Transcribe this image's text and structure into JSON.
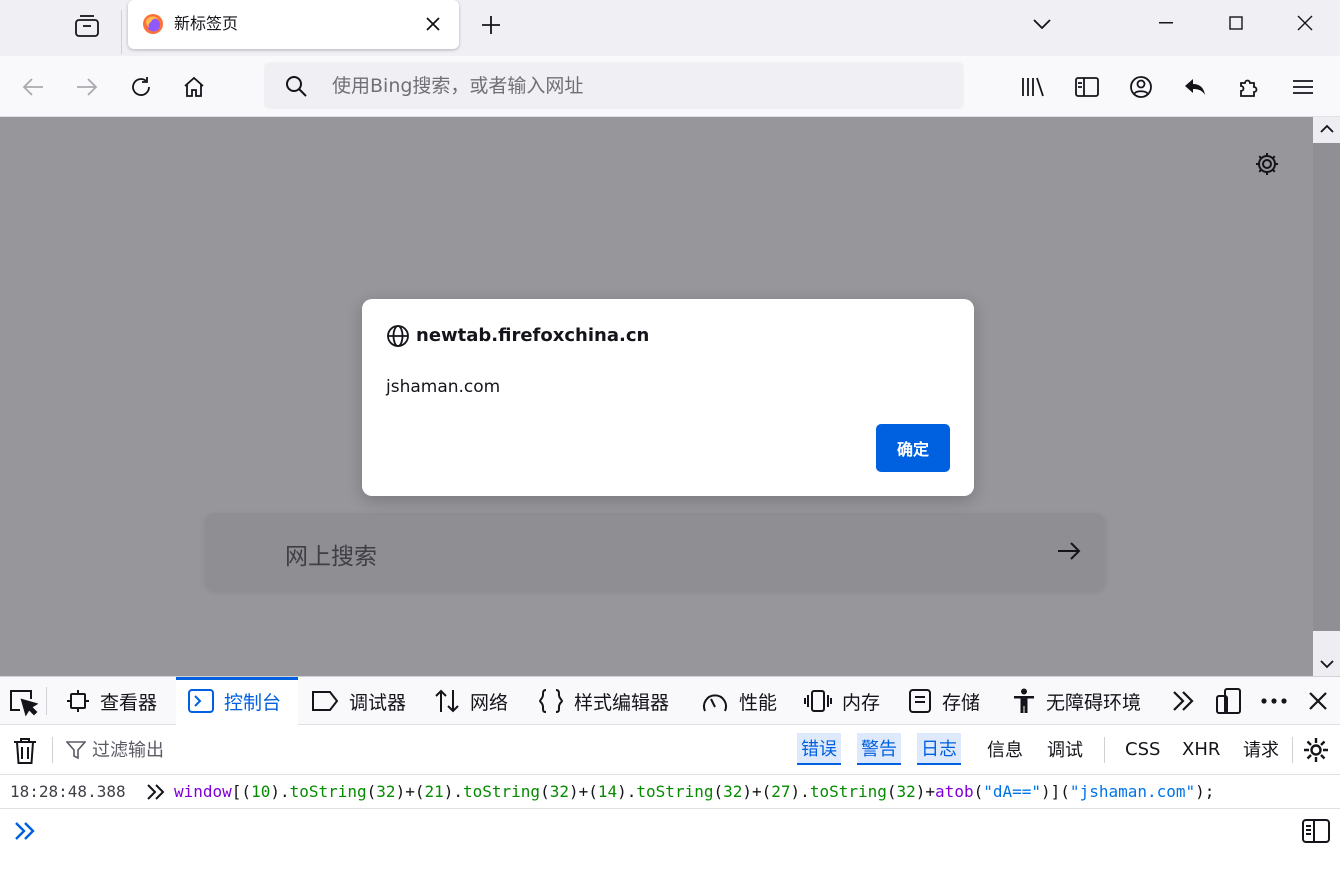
{
  "browser": {
    "tab": {
      "title": "新标签页"
    },
    "urlbar": {
      "placeholder": "使用Bing搜索，或者输入网址"
    }
  },
  "content": {
    "search_text": "网上搜索"
  },
  "dialog": {
    "origin": "newtab.firefoxchina.cn",
    "message": "jshaman.com",
    "ok_label": "确定"
  },
  "devtools": {
    "tabs": [
      {
        "label": "查看器",
        "icon": "inspector-icon"
      },
      {
        "label": "控制台",
        "icon": "console-icon",
        "active": true
      },
      {
        "label": "调试器",
        "icon": "debugger-icon"
      },
      {
        "label": "网络",
        "icon": "network-icon"
      },
      {
        "label": "样式编辑器",
        "icon": "style-editor-icon"
      },
      {
        "label": "性能",
        "icon": "performance-icon"
      },
      {
        "label": "内存",
        "icon": "memory-icon"
      },
      {
        "label": "存储",
        "icon": "storage-icon"
      },
      {
        "label": "无障碍环境",
        "icon": "accessibility-icon"
      }
    ],
    "filter_placeholder": "过滤输出",
    "filters": [
      {
        "label": "错误",
        "on": true
      },
      {
        "label": "警告",
        "on": true
      },
      {
        "label": "日志",
        "on": true
      },
      {
        "label": "信息",
        "on": false
      },
      {
        "label": "调试",
        "on": false
      },
      {
        "label": "CSS",
        "on": false
      },
      {
        "label": "XHR",
        "on": false
      },
      {
        "label": "请求",
        "on": false
      }
    ],
    "log": {
      "timestamp": "18:28:48.388",
      "code": {
        "p1": "window",
        "p2": "[(",
        "n1": "10",
        "p3": ").",
        "m1": "toString",
        "p4": "(",
        "n2": "32",
        "p5": ")+(",
        "n3": "21",
        "p6": ").",
        "m2": "toString",
        "p7": "(",
        "n4": "32",
        "p8": ")+(",
        "n5": "14",
        "p9": ").",
        "m3": "toString",
        "p10": "(",
        "n6": "32",
        "p11": ")+(",
        "n7": "27",
        "p12": ").",
        "m4": "toString",
        "p13": "(",
        "n8": "32",
        "p14": ")+",
        "f1": "atob",
        "p15": "(",
        "s1": "\"dA==\"",
        "p16": ")](",
        "s2": "\"jshaman.com\"",
        "p17": ");"
      }
    }
  }
}
